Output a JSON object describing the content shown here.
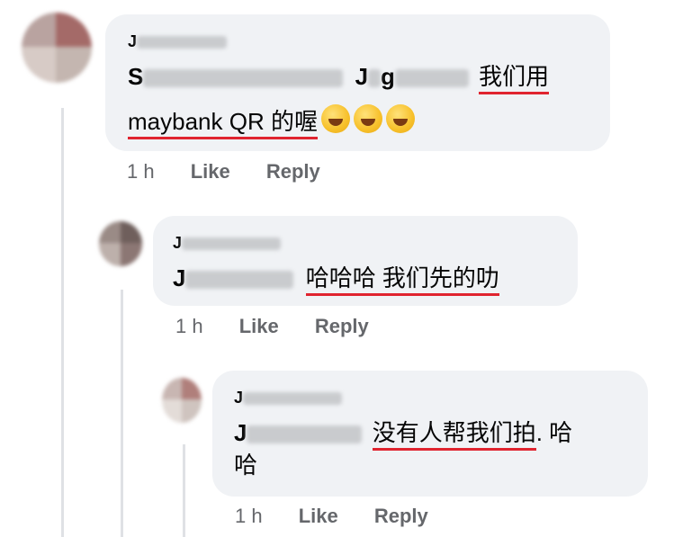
{
  "comments": [
    {
      "author": "J",
      "mention1_first": "S",
      "mention2_first": "J",
      "mention2_mid": "g",
      "text_line1": "我们用",
      "text_line2": "maybank QR 的喔",
      "emoji": "rolling-on-floor-laughing",
      "time": "1 h",
      "like": "Like",
      "reply": "Reply"
    },
    {
      "author": "J",
      "mention_first": "J",
      "text": "哈哈哈 我们先的叻",
      "time": "1 h",
      "like": "Like",
      "reply": "Reply"
    },
    {
      "author": "J",
      "mention_first": "J",
      "text_line1": "没有人帮我们拍",
      "text_tail": ". 哈",
      "text_line2": "哈",
      "time": "1 h",
      "like": "Like",
      "reply": "Reply"
    }
  ],
  "colors": {
    "bubble": "#f0f2f5",
    "underline": "#e0242f",
    "meta": "#65676b"
  }
}
